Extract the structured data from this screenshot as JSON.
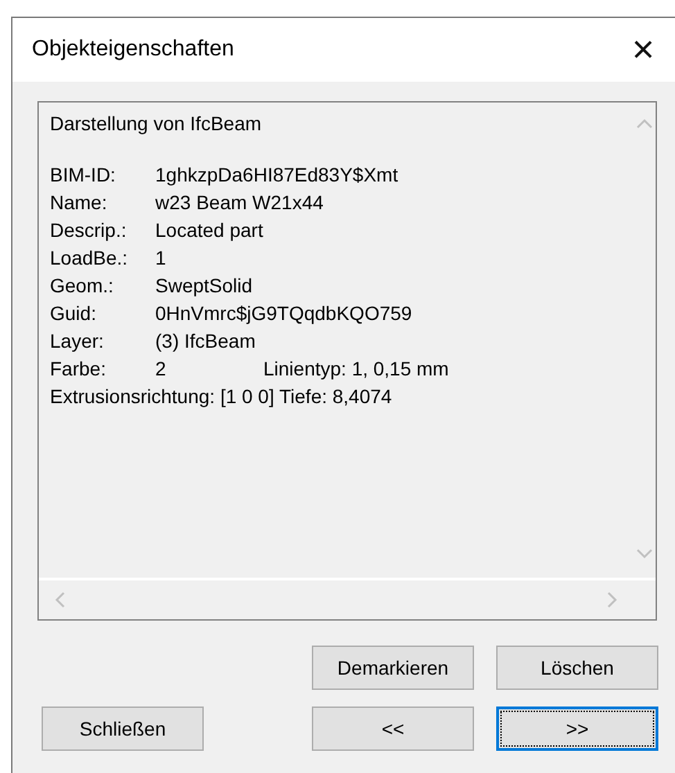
{
  "window": {
    "title": "Objekteigenschaften",
    "close": "×"
  },
  "content": {
    "heading": "Darstellung von IfcBeam",
    "rows": [
      {
        "kind": "pair",
        "label": "BIM-ID:",
        "value": "1ghkzpDa6HI87Ed83Y$Xmt"
      },
      {
        "kind": "pair",
        "label": "Name:",
        "value": "w23 Beam W21x44"
      },
      {
        "kind": "pair",
        "label": "Descrip.:",
        "value": "Located part"
      },
      {
        "kind": "pair",
        "label": "LoadBe.:",
        "value": "1"
      },
      {
        "kind": "pair",
        "label": "Geom.:",
        "value": "SweptSolid"
      },
      {
        "kind": "pair",
        "label": "Guid:",
        "value": "0HnVmrc$jG9TQqdbKQO759"
      },
      {
        "kind": "pair",
        "label": "Layer:",
        "value": "(3) IfcBeam"
      },
      {
        "kind": "pair_extra",
        "label": "Farbe:",
        "value": "2",
        "extra": "Linientyp: 1, 0,15 mm"
      },
      {
        "kind": "line",
        "text": "Extrusionsrichtung: [1 0 0] Tiefe: 8,4074"
      }
    ]
  },
  "buttons": [
    {
      "label": "Demarkieren",
      "focused": false
    },
    {
      "label": "Löschen",
      "focused": false
    },
    {
      "label": "Schließen",
      "focused": false
    },
    {
      "label": "<<",
      "focused": false
    },
    {
      "label": ">>",
      "focused": true
    }
  ]
}
